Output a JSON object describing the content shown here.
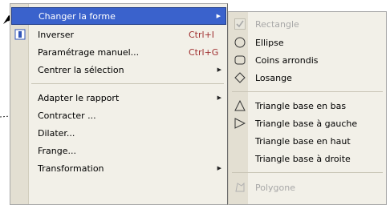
{
  "main_menu": {
    "items": [
      {
        "label": "Changer la forme",
        "highlighted": true,
        "submenu": true,
        "icon": ""
      },
      {
        "label": "Inverser",
        "shortcut": "Ctrl+I",
        "icon": "invert-icon"
      },
      {
        "label": "Paramétrage manuel...",
        "shortcut": "Ctrl+G",
        "icon": ""
      },
      {
        "label": "Centrer la sélection",
        "submenu": true,
        "icon": ""
      },
      {
        "label": "Adapter le rapport",
        "submenu": true,
        "icon": ""
      },
      {
        "label": "Contracter ...",
        "icon": ""
      },
      {
        "label": "Dilater...",
        "icon": ""
      },
      {
        "label": "Frange...",
        "icon": ""
      },
      {
        "label": "Transformation",
        "submenu": true,
        "icon": ""
      }
    ]
  },
  "sub_menu": {
    "items": [
      {
        "label": "Rectangle",
        "disabled": true,
        "icon": "checkmark-icon"
      },
      {
        "label": "Ellipse",
        "icon": "ellipse-icon"
      },
      {
        "label": "Coins arrondis",
        "icon": "rounded-rect-icon"
      },
      {
        "label": "Losange",
        "icon": "diamond-icon"
      },
      {
        "label": "Triangle base en bas",
        "icon": "triangle-up-icon"
      },
      {
        "label": "Triangle base à gauche",
        "icon": "triangle-right-icon"
      },
      {
        "label": "Triangle base en haut",
        "icon": ""
      },
      {
        "label": "Triangle base à droite",
        "icon": ""
      },
      {
        "label": "Polygone",
        "disabled": true,
        "icon": "polygon-icon"
      }
    ]
  },
  "colors": {
    "highlight": "#3a62cc",
    "menu_bg": "#f2f0e8",
    "shortcut": "#a03030",
    "disabled": "#a8a8a8"
  }
}
